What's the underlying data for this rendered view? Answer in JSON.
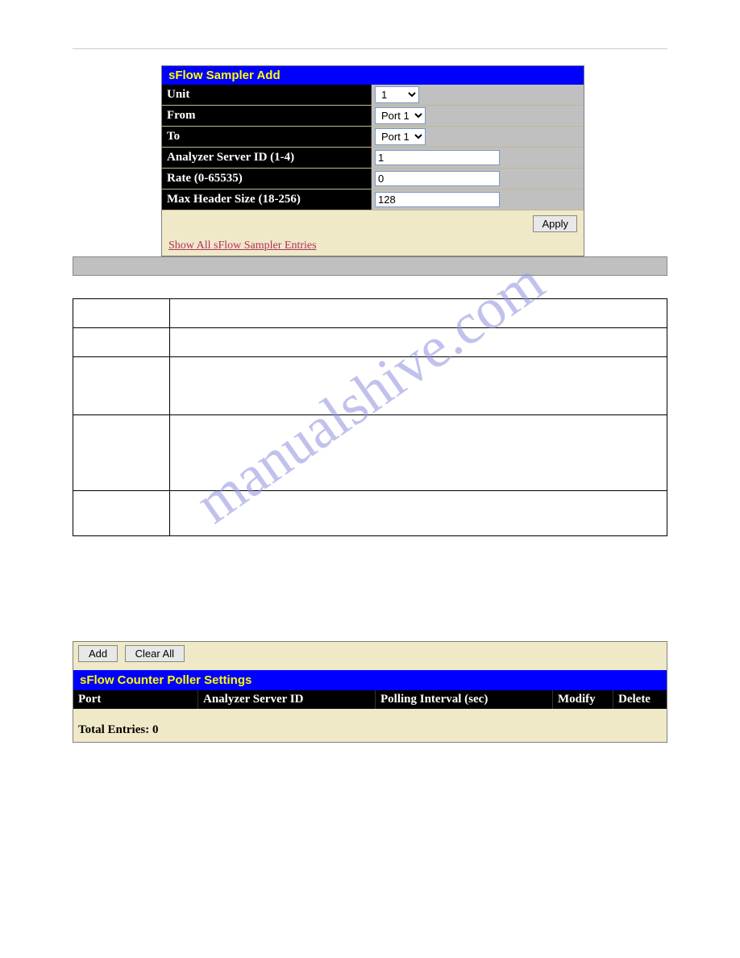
{
  "watermark": "manualshive.com",
  "sampler": {
    "header": "sFlow Sampler Add",
    "rows": {
      "unit_label": "Unit",
      "unit_value": "1",
      "from_label": "From",
      "from_value": "Port 1",
      "to_label": "To",
      "to_value": "Port 1",
      "analyzer_label": "Analyzer Server ID (1-4)",
      "analyzer_value": "1",
      "rate_label": "Rate (0-65535)",
      "rate_value": "0",
      "maxheader_label": "Max Header Size (18-256)",
      "maxheader_value": "128"
    },
    "apply_label": "Apply",
    "link_label": "Show All sFlow Sampler Entries"
  },
  "poller": {
    "add_label": "Add",
    "clear_label": "Clear All",
    "header": "sFlow Counter Poller Settings",
    "columns": {
      "port": "Port",
      "analyzer": "Analyzer Server ID",
      "interval": "Polling Interval (sec)",
      "modify": "Modify",
      "delete": "Delete"
    },
    "total_label": "Total Entries: 0"
  }
}
